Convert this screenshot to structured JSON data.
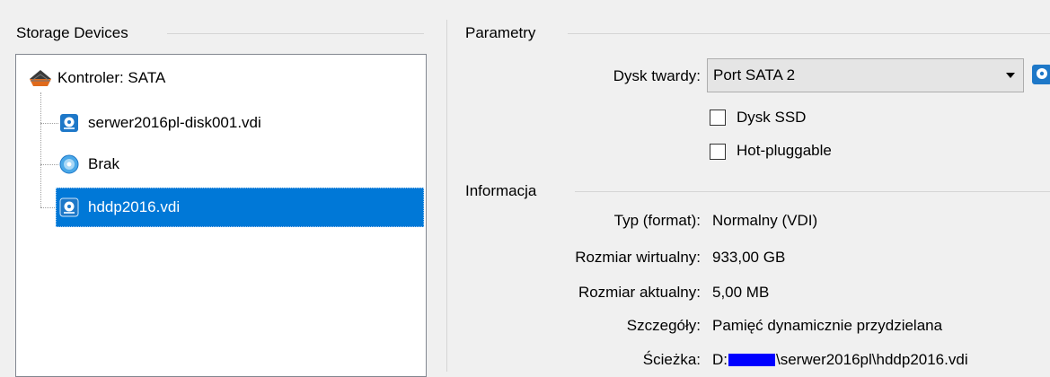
{
  "storage": {
    "title": "Storage Devices",
    "controller": {
      "label": "Kontroler: SATA",
      "icon": "sata-controller-icon"
    },
    "items": [
      {
        "label": "serwer2016pl-disk001.vdi",
        "icon": "hard-disk-icon"
      },
      {
        "label": "Brak",
        "icon": "optical-disk-icon"
      },
      {
        "label": "hddp2016.vdi",
        "icon": "hard-disk-icon",
        "selected": true
      }
    ]
  },
  "params": {
    "title": "Parametry",
    "disk_label": "Dysk twardy:",
    "disk_value": "Port SATA 2",
    "ssd_label": "Dysk SSD",
    "ssd_checked": false,
    "hotplug_label": "Hot-pluggable",
    "hotplug_checked": false
  },
  "info": {
    "title": "Informacja",
    "type_label": "Typ (format):",
    "type_value": "Normalny (VDI)",
    "virtual_label": "Rozmiar wirtualny:",
    "virtual_value": "933,00 GB",
    "actual_label": "Rozmiar aktualny:",
    "actual_value": "5,00 MB",
    "details_label": "Szczegóły:",
    "details_value": "Pamięć dynamicznie przydzielana",
    "path_label": "Ścieżka:",
    "path_prefix": "D:",
    "path_suffix": "\\serwer2016pl\\hddp2016.vdi"
  },
  "colors": {
    "selection": "#0078d7",
    "disk_icon": "#1e78c8",
    "redaction": "#0000ff"
  }
}
